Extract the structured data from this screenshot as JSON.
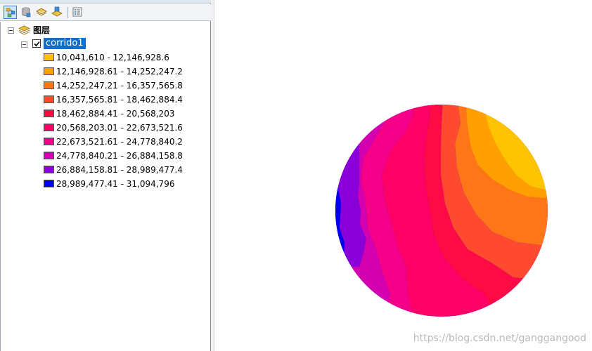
{
  "toc": {
    "tools": [
      {
        "name": "list-by-drawing-order",
        "selected": true
      },
      {
        "name": "list-by-source",
        "selected": false
      },
      {
        "name": "list-by-visibility",
        "selected": false
      },
      {
        "name": "list-by-selection",
        "selected": false
      },
      {
        "name": "options",
        "selected": false
      }
    ],
    "root_label": "图层",
    "layer": {
      "name": "corrido1",
      "checked": true
    },
    "legend": [
      {
        "label": "10,041,610 - 12,146,928.6",
        "color": "#ffc300"
      },
      {
        "label": "12,146,928.61 - 14,252,247.2",
        "color": "#ff9f00"
      },
      {
        "label": "14,252,247.21 - 16,357,565.8",
        "color": "#ff7619"
      },
      {
        "label": "16,357,565.81 - 18,462,884.4",
        "color": "#ff4a30"
      },
      {
        "label": "18,462,884.41 - 20,568,203",
        "color": "#ff0a44"
      },
      {
        "label": "20,568,203.01 - 22,673,521.6",
        "color": "#ff0066"
      },
      {
        "label": "22,673,521.61 - 24,778,840.2",
        "color": "#f50088"
      },
      {
        "label": "24,778,840.21 - 26,884,158.8",
        "color": "#d400b0"
      },
      {
        "label": "26,884,158.81 - 28,989,477.4",
        "color": "#8a00d8"
      },
      {
        "label": "28,989,477.41 - 31,094,796",
        "color": "#0000ef"
      }
    ]
  },
  "map": {
    "watermark": "https://blog.csdn.net/ganggangood"
  }
}
